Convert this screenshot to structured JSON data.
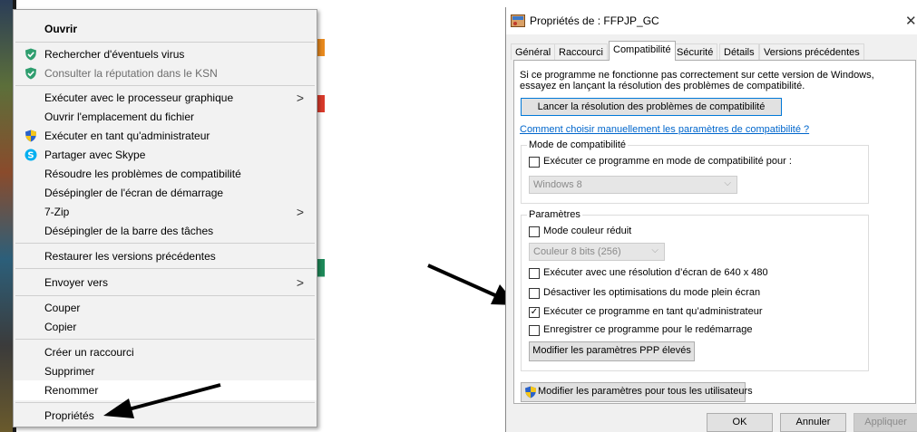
{
  "context_menu": {
    "items": [
      {
        "label": "Ouvrir",
        "bold": true
      },
      {
        "label": "Rechercher d'éventuels virus",
        "icon": "shield-check-icon"
      },
      {
        "label": "Consulter la réputation dans le KSN",
        "icon": "shield-check-icon",
        "disabled": true
      },
      {
        "label": "Exécuter avec le processeur graphique",
        "submenu": true
      },
      {
        "label": "Ouvrir l'emplacement du fichier"
      },
      {
        "label": "Exécuter en tant qu'administrateur",
        "icon": "uac-shield-icon"
      },
      {
        "label": "Partager avec Skype",
        "icon": "skype-icon"
      },
      {
        "label": "Résoudre les problèmes de compatibilité"
      },
      {
        "label": "Désépingler de l'écran de démarrage"
      },
      {
        "label": "7-Zip",
        "submenu": true
      },
      {
        "label": "Désépingler de la barre des tâches"
      },
      {
        "label": "Restaurer les versions précédentes"
      },
      {
        "label": "Envoyer vers",
        "submenu": true
      },
      {
        "label": "Couper"
      },
      {
        "label": "Copier"
      },
      {
        "label": "Créer un raccourci"
      },
      {
        "label": "Supprimer"
      },
      {
        "label": "Renommer"
      },
      {
        "label": "Propriétés",
        "highlighted": true
      }
    ],
    "submenu_arrow": ">"
  },
  "dialog": {
    "title": "Propriétés de : FFPJP_GC",
    "close": "✕",
    "tabs": [
      "Général",
      "Raccourci",
      "Compatibilité",
      "Sécurité",
      "Détails",
      "Versions précédentes"
    ],
    "active_tab": "Compatibilité",
    "intro_line1": "Si ce programme ne fonctionne pas correctement sur cette version de Windows,",
    "intro_line2": "essayez en lançant la résolution des problèmes de compatibilité.",
    "troubleshoot_button": "Lancer la résolution des problèmes de compatibilité",
    "manual_link": "Comment choisir manuellement les paramètres de compatibilité ?",
    "compat_mode": {
      "title": "Mode de compatibilité",
      "checkbox_label": "Exécuter ce programme en mode de compatibilité pour :",
      "checked": false,
      "os_value": "Windows 8"
    },
    "settings": {
      "title": "Paramètres",
      "reduced_color_label": "Mode couleur réduit",
      "reduced_color_checked": false,
      "color_value": "Couleur 8 bits (256)",
      "resolution_label": "Exécuter avec une résolution d’écran de 640 x 480",
      "resolution_checked": false,
      "fullscreen_label": "Désactiver les optimisations du mode plein écran",
      "fullscreen_checked": false,
      "admin_label": "Exécuter ce programme en tant qu’administrateur",
      "admin_checked": true,
      "restart_label": "Enregistrer ce programme pour le redémarrage",
      "restart_checked": false,
      "dpi_button": "Modifier les paramètres PPP élevés"
    },
    "all_users_button": "Modifier les paramètres pour tous les utilisateurs",
    "ok": "OK",
    "cancel": "Annuler",
    "apply": "Appliquer",
    "check_mark": "✓"
  },
  "colors": {
    "kaspersky_green": "#2f9e6f",
    "skype_blue": "#00aff0",
    "uac_blue": "#2a62c9",
    "uac_yellow": "#f5c518",
    "link": "#0066cc",
    "arrow": "#000000"
  }
}
